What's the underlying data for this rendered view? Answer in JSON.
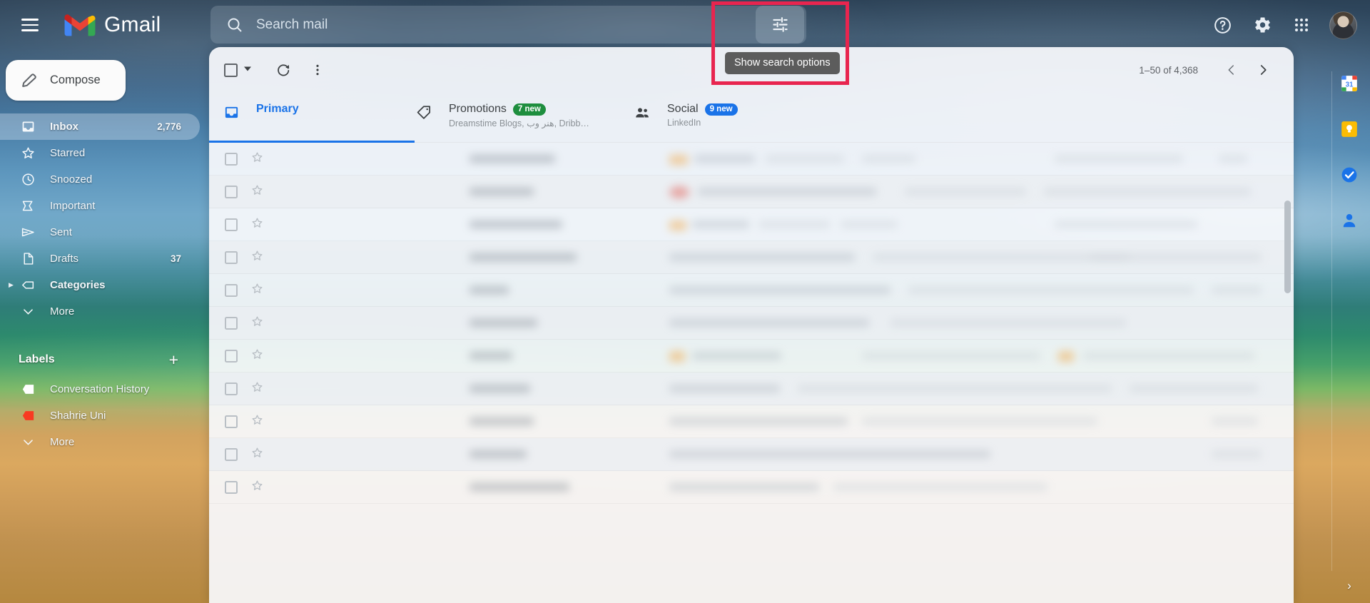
{
  "app": {
    "name": "Gmail",
    "menu_icon": "hamburger-menu-icon"
  },
  "search": {
    "placeholder": "Search mail",
    "value": "",
    "icon": "search-icon",
    "options_icon": "tune-icon",
    "tooltip": "Show search options"
  },
  "topright": {
    "help": "help-icon",
    "settings": "gear-icon",
    "apps": "apps-grid-icon",
    "avatar": "user-avatar"
  },
  "sidebar": {
    "compose": {
      "label": "Compose",
      "icon": "pencil-icon"
    },
    "items": [
      {
        "label": "Inbox",
        "icon": "inbox-icon",
        "count": "2,776",
        "active": true,
        "expandable": false
      },
      {
        "label": "Starred",
        "icon": "star-icon",
        "count": "",
        "active": false,
        "expandable": false
      },
      {
        "label": "Snoozed",
        "icon": "clock-icon",
        "count": "",
        "active": false,
        "expandable": false
      },
      {
        "label": "Important",
        "icon": "important-icon",
        "count": "",
        "active": false,
        "expandable": false
      },
      {
        "label": "Sent",
        "icon": "send-icon",
        "count": "",
        "active": false,
        "expandable": false
      },
      {
        "label": "Drafts",
        "icon": "draft-icon",
        "count": "37",
        "active": false,
        "expandable": false
      },
      {
        "label": "Categories",
        "icon": "tag-icon",
        "count": "",
        "active": false,
        "expandable": true
      },
      {
        "label": "More",
        "icon": "chevron-down-icon",
        "count": "",
        "active": false,
        "expandable": false
      }
    ],
    "labels_header": {
      "title": "Labels",
      "add_icon": "plus-icon",
      "add_label": "+"
    },
    "labels": [
      {
        "label": "Conversation History",
        "icon": "tag-icon",
        "color": "#ffffff"
      },
      {
        "label": "Shahrie Uni",
        "icon": "tag-icon",
        "color": "#f83a22"
      },
      {
        "label": "More",
        "icon": "chevron-down-icon",
        "color": ""
      }
    ]
  },
  "toolbar": {
    "select_all_icon": "checkbox-icon",
    "select_caret_icon": "chevron-down-icon",
    "refresh_icon": "refresh-icon",
    "more_icon": "more-vertical-icon",
    "pagination": {
      "range": "1–50 of 4,368",
      "prev_icon": "chevron-left-icon",
      "next_icon": "chevron-right-icon"
    }
  },
  "tabs": [
    {
      "label": "Primary",
      "icon": "inbox-tab-icon",
      "badge": "",
      "badge_color": "",
      "subtitle": "",
      "selected": true
    },
    {
      "label": "Promotions",
      "icon": "tag-tab-icon",
      "badge": "7 new",
      "badge_color": "#1e8e3e",
      "subtitle": "Dreamstime Blogs, هنر وب, Dribb…",
      "selected": false
    },
    {
      "label": "Social",
      "icon": "people-tab-icon",
      "badge": "9 new",
      "badge_color": "#1a73e8",
      "subtitle": "LinkedIn",
      "selected": false
    }
  ],
  "message_list": {
    "rows": [
      {
        "checkbox": "row-checkbox",
        "star": "star-icon",
        "content": "obscured"
      },
      {
        "checkbox": "row-checkbox",
        "star": "star-icon",
        "content": "obscured"
      },
      {
        "checkbox": "row-checkbox",
        "star": "star-icon",
        "content": "obscured"
      },
      {
        "checkbox": "row-checkbox",
        "star": "star-icon",
        "content": "obscured"
      },
      {
        "checkbox": "row-checkbox",
        "star": "star-icon",
        "content": "obscured"
      },
      {
        "checkbox": "row-checkbox",
        "star": "star-icon",
        "content": "obscured"
      },
      {
        "checkbox": "row-checkbox",
        "star": "star-icon",
        "content": "obscured"
      },
      {
        "checkbox": "row-checkbox",
        "star": "star-icon",
        "content": "obscured"
      },
      {
        "checkbox": "row-checkbox",
        "star": "star-icon",
        "content": "obscured"
      },
      {
        "checkbox": "row-checkbox",
        "star": "star-icon",
        "content": "obscured"
      },
      {
        "checkbox": "row-checkbox",
        "star": "star-icon",
        "content": "obscured"
      }
    ]
  },
  "side_panel": {
    "items": [
      {
        "name": "google-calendar-icon"
      },
      {
        "name": "google-keep-icon"
      },
      {
        "name": "google-tasks-icon"
      },
      {
        "name": "google-contacts-icon"
      }
    ],
    "expand_label": "›"
  },
  "colors": {
    "accent_blue": "#1a73e8",
    "badge_green": "#1e8e3e",
    "badge_blue": "#1a73e8",
    "highlight_red": "#e8254f",
    "label_red": "#f83a22"
  }
}
